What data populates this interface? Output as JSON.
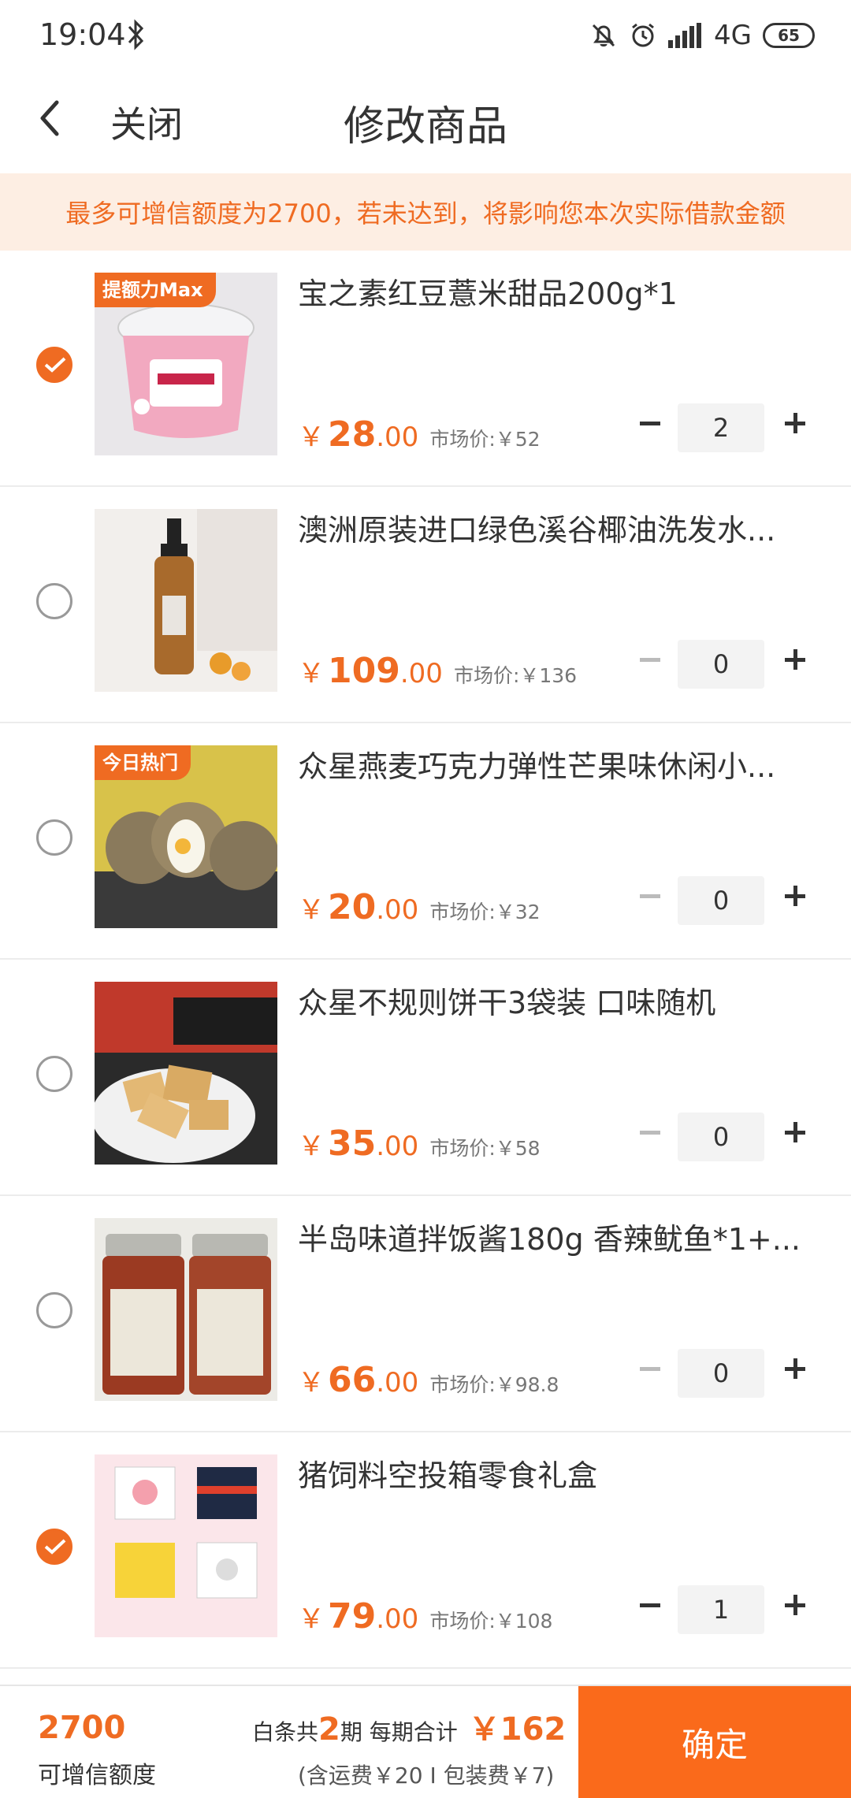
{
  "status_bar": {
    "time": "19:04",
    "network": "4G",
    "battery": "65"
  },
  "header": {
    "close_label": "关闭",
    "title": "修改商品"
  },
  "notice": "最多可增信额度为2700，若未达到，将影响您本次实际借款金额",
  "items": [
    {
      "name": "宝之素红豆薏米甜品200g*1",
      "badge": "提额力Max",
      "price_int": "28",
      "price_dec": ".00",
      "currency": "￥",
      "market": "市场价:￥52",
      "qty": "2",
      "checked": true
    },
    {
      "name": "澳洲原装进口绿色溪谷椰油洗发水...",
      "badge": "",
      "price_int": "109",
      "price_dec": ".00",
      "currency": "￥",
      "market": "市场价:￥136",
      "qty": "0",
      "checked": false
    },
    {
      "name": "众星燕麦巧克力弹性芒果味休闲小...",
      "badge": "今日热门",
      "price_int": "20",
      "price_dec": ".00",
      "currency": "￥",
      "market": "市场价:￥32",
      "qty": "0",
      "checked": false
    },
    {
      "name": "众星不规则饼干3袋装 口味随机",
      "badge": "",
      "price_int": "35",
      "price_dec": ".00",
      "currency": "￥",
      "market": "市场价:￥58",
      "qty": "0",
      "checked": false
    },
    {
      "name": "半岛味道拌饭酱180g 香辣鱿鱼*1+...",
      "badge": "",
      "price_int": "66",
      "price_dec": ".00",
      "currency": "￥",
      "market": "市场价:￥98.8",
      "qty": "0",
      "checked": false
    },
    {
      "name": "猪饲料空投箱零食礼盒",
      "badge": "",
      "price_int": "79",
      "price_dec": ".00",
      "currency": "￥",
      "market": "市场价:￥108",
      "qty": "1",
      "checked": true
    }
  ],
  "footer": {
    "limit_value": "2700",
    "limit_label": "可增信额度",
    "plan_prefix": "白条共",
    "periods": "2",
    "plan_mid": "期  每期合计",
    "per_period": "￥162",
    "fee_note": "(含运费￥20 I 包装费￥7)",
    "confirm": "确定"
  },
  "colors": {
    "accent": "#ef6b22",
    "notice_bg": "#fdeee3",
    "confirm_bg": "#fa6a1b"
  }
}
